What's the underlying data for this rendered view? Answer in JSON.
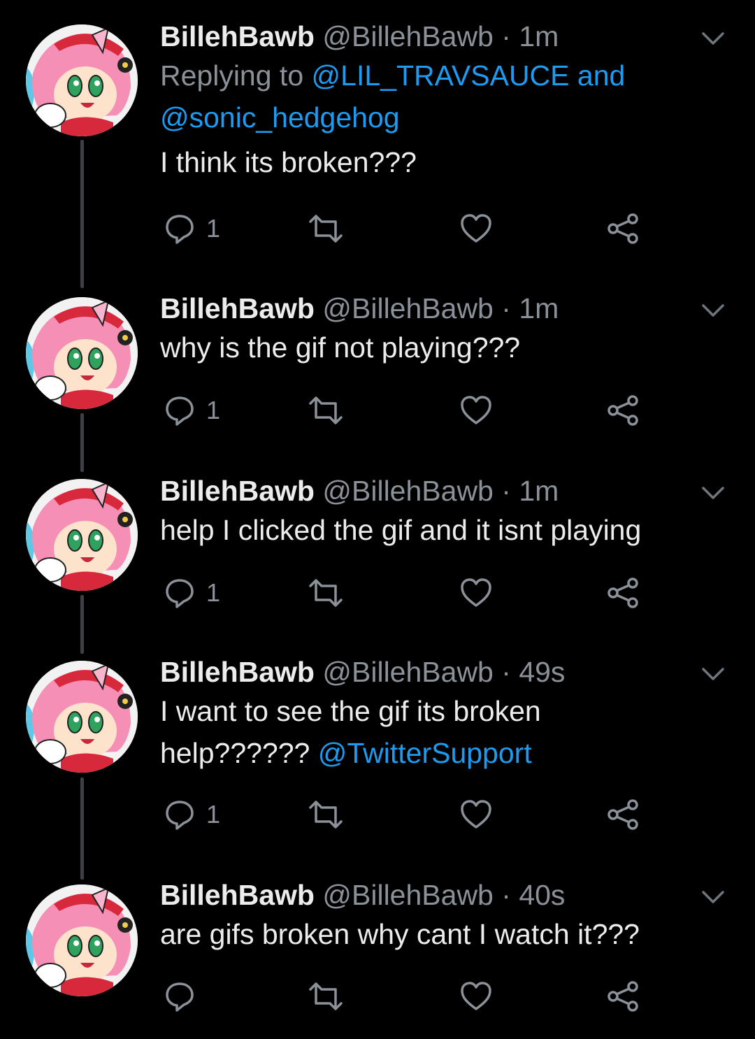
{
  "thread": [
    {
      "display_name": "BillehBawb",
      "handle": "@BillehBawb",
      "separator": "·",
      "time": "1m",
      "replying_prefix": "Replying to",
      "reply_user_1": "@LIL_TRAVSAUCE",
      "reply_joiner": "and",
      "reply_user_2": "@sonic_hedgehog",
      "text": "I think its broken???",
      "reply_count": "1"
    },
    {
      "display_name": "BillehBawb",
      "handle": "@BillehBawb",
      "separator": "·",
      "time": "1m",
      "text": "why is the gif not playing???",
      "reply_count": "1"
    },
    {
      "display_name": "BillehBawb",
      "handle": "@BillehBawb",
      "separator": "·",
      "time": "1m",
      "text": "help I clicked the gif and it isnt playing",
      "reply_count": "1"
    },
    {
      "display_name": "BillehBawb",
      "handle": "@BillehBawb",
      "separator": "·",
      "time": "49s",
      "text_line1": "I want to see the gif its broken",
      "text_line2": "help??????",
      "mention": "@TwitterSupport",
      "reply_count": "1"
    },
    {
      "display_name": "BillehBawb",
      "handle": "@BillehBawb",
      "separator": "·",
      "time": "40s",
      "text": "are gifs broken why cant I watch it???",
      "reply_count": ""
    }
  ],
  "icons": {
    "reply": "reply-icon",
    "retweet": "retweet-icon",
    "like": "heart-icon",
    "share": "share-icon",
    "menu": "chevron-down-icon"
  },
  "colors": {
    "background": "#000000",
    "link": "#1d9bf0",
    "muted": "#8b9199",
    "text": "#ececec"
  }
}
